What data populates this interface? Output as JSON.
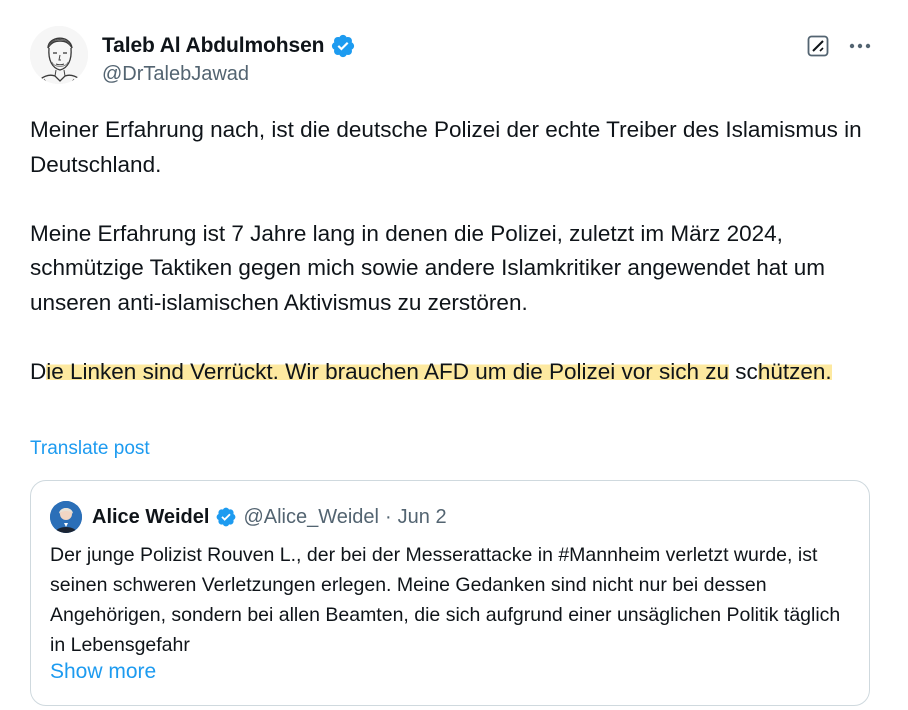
{
  "author": {
    "display_name": "Taleb Al Abdulmohsen",
    "handle": "@DrTalebJawad",
    "avatar_icon": "sketch-portrait-avatar",
    "verified": true
  },
  "actions": {
    "grok_icon": "grok-icon",
    "more_icon": "more-horizontal-icon"
  },
  "text": {
    "p1": "Meiner Erfahrung nach, ist die deutsche Polizei der echte Treiber des Islamismus in Deutschland.",
    "p2": "Meine Erfahrung ist 7 Jahre lang in denen die Polizei, zuletzt im März 2024, schmützige Taktiken gegen mich sowie andere Islamkritiker angewendet hat um unseren anti-islamischen Aktivismus zu zerstören.",
    "p3_start": "D",
    "p3_highlight_1": "ie Linken sind Verrückt. Wir brauchen AFD um die Polizei vor sich zu",
    "p3_mid": " sc",
    "p3_highlight_2": "hützen."
  },
  "translate_label": "Translate post",
  "quote": {
    "display_name": "Alice Weidel",
    "handle": "@Alice_Weidel",
    "dot": "·",
    "date": "Jun 2",
    "verified": true,
    "text": "Der junge Polizist Rouven L., der bei der Messerattacke in #Mannheim verletzt wurde, ist seinen schweren Verletzungen erlegen. Meine Gedanken sind nicht nur bei dessen Angehörigen, sondern bei allen Beamten, die sich aufgrund einer unsäglichen Politik täglich in Lebensgefahr",
    "show_more": "Show more"
  },
  "colors": {
    "text": "#0f1419",
    "secondary": "#536471",
    "link": "#1d9bf0",
    "verified": "#1d9bf0",
    "highlight": "#fde9a0",
    "border": "#cfd9de"
  }
}
